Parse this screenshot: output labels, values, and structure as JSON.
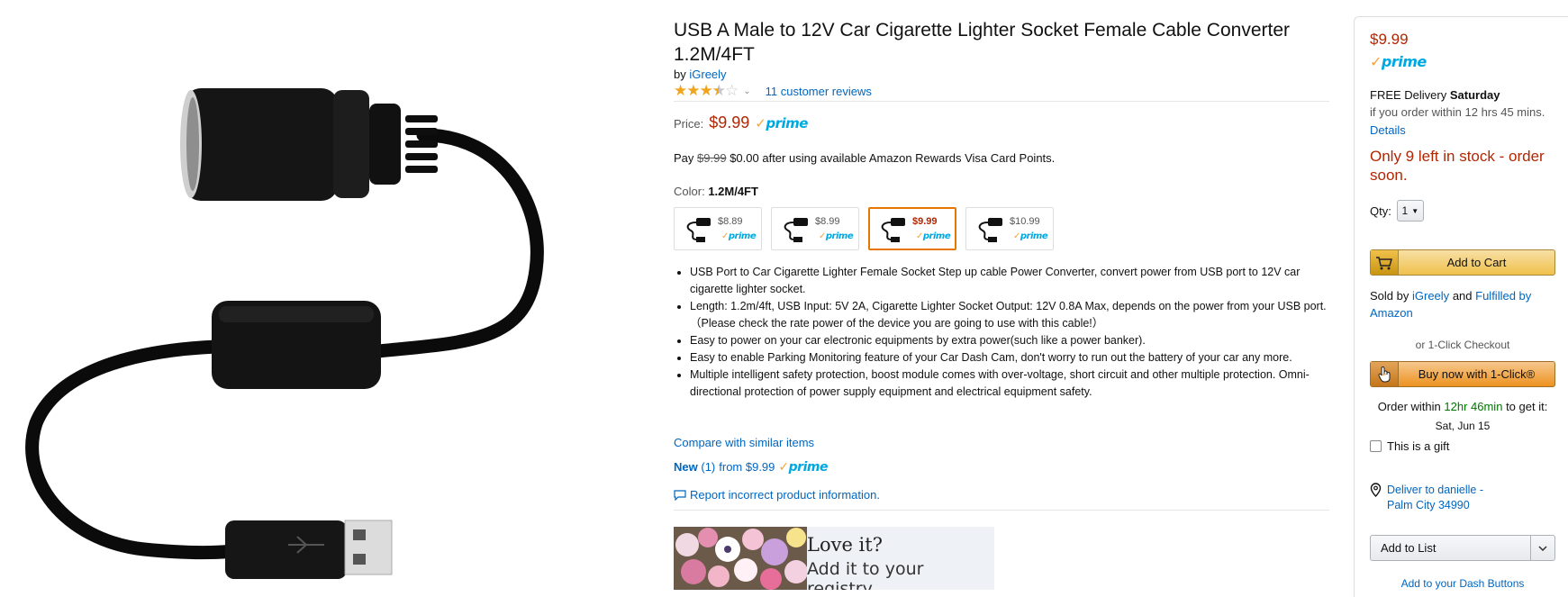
{
  "product": {
    "title": "USB A Male to 12V Car Cigarette Lighter Socket Female Cable Converter 1.2M/4FT",
    "by_label": "by",
    "brand": "iGreely",
    "rating": 3.5,
    "reviews_text": "11 customer reviews",
    "price_label": "Price:",
    "price": "$9.99",
    "rewards": {
      "prefix": "Pay",
      "old_price": "$9.99",
      "rest": "$0.00 after using available Amazon Rewards Visa Card Points."
    },
    "color_label": "Color:",
    "color_value": "1.2M/4FT",
    "variants": [
      {
        "price": "$8.89",
        "prime": "prime",
        "selected": false
      },
      {
        "price": "$8.99",
        "prime": "prime",
        "selected": false
      },
      {
        "price": "$9.99",
        "prime": "prime",
        "selected": true
      },
      {
        "price": "$10.99",
        "prime": "prime",
        "selected": false
      }
    ],
    "bullets": [
      "USB Port to Car Cigarette Lighter Female Socket Step up cable Power Converter, convert power from USB port to 12V car cigarette lighter socket.",
      "Length: 1.2m/4ft, USB Input: 5V 2A, Cigarette Lighter Socket Output: 12V 0.8A Max, depends on the power from your USB port. （Please check the rate power of the device you are going to use with this cable!）",
      "Easy to power on your car electronic equipments by extra power(such like a power banker).",
      "Easy to enable Parking Monitoring feature of your Car Dash Cam, don't worry to run out the battery of your car any more.",
      "Multiple intelligent safety protection, boost module comes with over-voltage, short circuit and other multiple protection. Omni-directional protection of power supply equipment and electrical equipment safety."
    ],
    "compare_link": "Compare with similar items",
    "new_label": "New",
    "new_count": "(1)",
    "new_from": "from $9.99",
    "report_link": "Report incorrect product information.",
    "registry": {
      "line1": "Love it?",
      "line2": "Add it to your registry."
    }
  },
  "prime_word": "prime",
  "buybox": {
    "price": "$9.99",
    "delivery_prefix": "FREE Delivery",
    "delivery_day": "Saturday",
    "order_within": "if you order within 12 hrs 45 mins.",
    "details": "Details",
    "stock": "Only 9 left in stock - order soon.",
    "qty_label": "Qty:",
    "qty_value": "1",
    "add_to_cart": "Add to Cart",
    "sold_by_prefix": "Sold by",
    "seller": "iGreely",
    "and": "and",
    "fulfilled": "Fulfilled by Amazon",
    "one_click_divider": "or 1-Click Checkout",
    "buy_now": "Buy now with 1-Click®",
    "order_prefix": "Order within",
    "order_time": "12hr 46min",
    "order_suffix": "to get it:",
    "arrival": "Sat, Jun 15",
    "gift_label": "This is a gift",
    "deliver_line1": "Deliver to danielle -",
    "deliver_line2": "Palm City 34990",
    "add_to_list": "Add to List",
    "dash_buttons": "Add to your Dash Buttons"
  },
  "colors": {
    "price_red": "#b12704",
    "link_blue": "#0066c0",
    "prime_blue": "#00a8e1",
    "button_gold": "#f0c14b",
    "button_orange": "#ed9220"
  }
}
